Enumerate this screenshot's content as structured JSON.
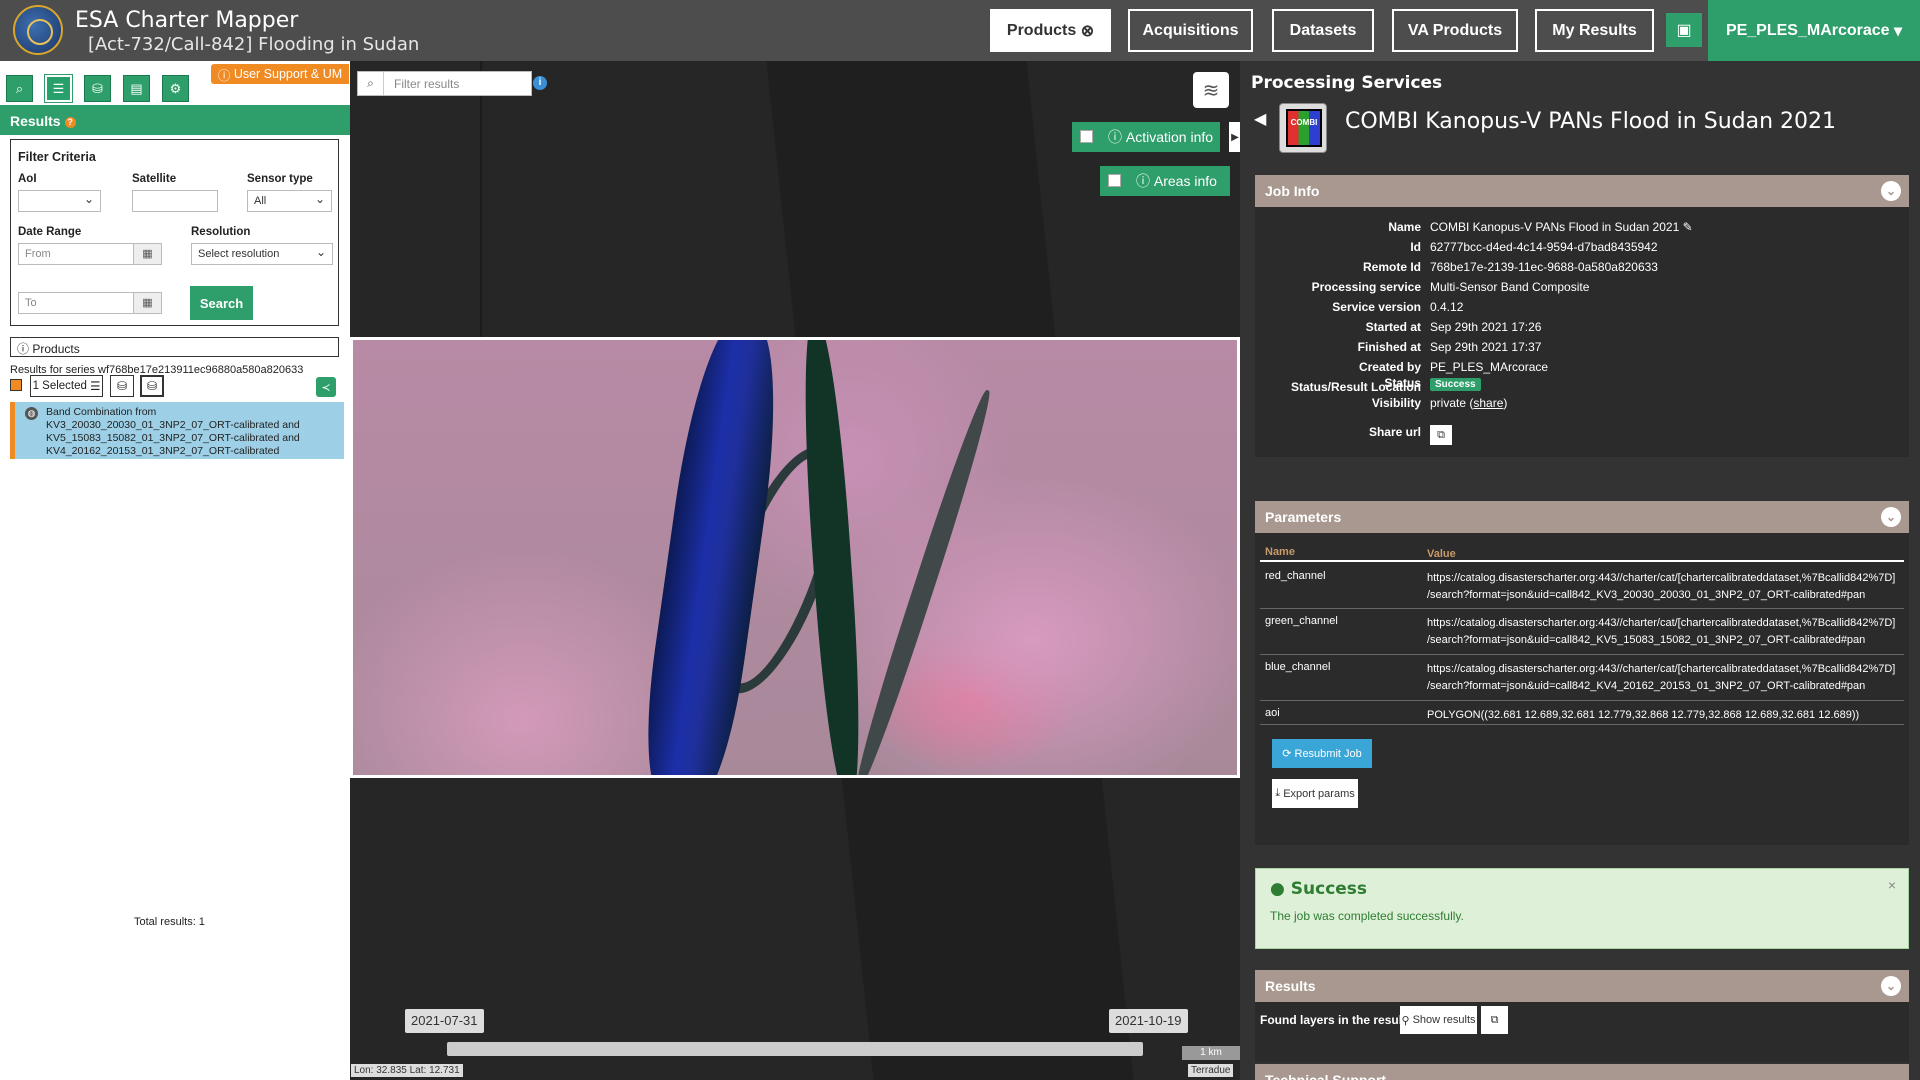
{
  "header": {
    "app_title": "ESA Charter Mapper",
    "activation_title": "[Act-732/Call-842] Flooding in Sudan",
    "nav": {
      "products": "Products",
      "acquisitions": "Acquisitions",
      "datasets": "Datasets",
      "va_products": "VA Products",
      "my_results": "My Results"
    },
    "user": "PE_PLES_MArcorace"
  },
  "left_panel": {
    "support": "User Support & UM",
    "results_heading": "Results",
    "filter": {
      "heading": "Filter Criteria",
      "aoi_label": "AoI",
      "satellite_label": "Satellite",
      "sensor_label": "Sensor type",
      "sensor_value": "All",
      "date_label": "Date Range",
      "from_placeholder": "From",
      "to_placeholder": "To",
      "resolution_label": "Resolution",
      "resolution_value": "Select resolution",
      "search_label": "Search"
    },
    "products_heading": "Products",
    "series_text": "Results for series wf768be17e213911ec96880a580a820633",
    "selected_label": "1 Selected",
    "result_item": "Band Combination from KV3_20030_20030_01_3NP2_07_ORT-calibrated and KV5_15083_15082_01_3NP2_07_ORT-calibrated and KV4_20162_20153_01_3NP2_07_ORT-calibrated",
    "total": "Total results: 1"
  },
  "map": {
    "filter_placeholder": "Filter results",
    "activation_info": "Activation info",
    "areas_info": "Areas info",
    "date_start": "2021-07-31",
    "date_end": "2021-10-19",
    "scale": "1 km",
    "coords": "Lon: 32.835 Lat: 12.731",
    "credit": "Terradue"
  },
  "right_panel": {
    "section_title": "Processing Services",
    "service_title": "COMBI Kanopus-V PANs Flood in Sudan 2021",
    "icon_text": "COMBI",
    "job_info": {
      "heading": "Job Info",
      "rows": [
        {
          "k": "Name",
          "v": "COMBI Kanopus-V PANs Flood in Sudan 2021 ✎"
        },
        {
          "k": "Id",
          "v": "62777bcc-d4ed-4c14-9594-d7bad8435942"
        },
        {
          "k": "Remote Id",
          "v": "768be17e-2139-11ec-9688-0a580a820633"
        },
        {
          "k": "Processing service",
          "v": "Multi-Sensor Band Composite"
        },
        {
          "k": "Service version",
          "v": "0.4.12"
        },
        {
          "k": "Started at",
          "v": "Sep 29th 2021 17:26"
        },
        {
          "k": "Finished at",
          "v": "Sep 29th 2021 17:37"
        },
        {
          "k": "Created by",
          "v": "PE_PLES_MArcorace"
        },
        {
          "k": "Status/Result Location",
          "v": "⇗"
        }
      ],
      "status_label": "Status",
      "status_value": "Success",
      "visibility_label": "Visibility",
      "visibility_value": "private",
      "share_link": "share",
      "share_url_label": "Share url"
    },
    "parameters": {
      "heading": "Parameters",
      "col_name": "Name",
      "col_value": "Value",
      "rows": [
        {
          "name": "red_channel",
          "line1": "https://catalog.disasterscharter.org:443//charter/cat/[chartercalibrateddataset,%7Bcallid842%7D]",
          "line2": "/search?format=json&uid=call842_KV3_20030_20030_01_3NP2_07_ORT-calibrated#pan"
        },
        {
          "name": "green_channel",
          "line1": "https://catalog.disasterscharter.org:443//charter/cat/[chartercalibrateddataset,%7Bcallid842%7D]",
          "line2": "/search?format=json&uid=call842_KV5_15083_15082_01_3NP2_07_ORT-calibrated#pan"
        },
        {
          "name": "blue_channel",
          "line1": "https://catalog.disasterscharter.org:443//charter/cat/[chartercalibrateddataset,%7Bcallid842%7D]",
          "line2": "/search?format=json&uid=call842_KV4_20162_20153_01_3NP2_07_ORT-calibrated#pan"
        },
        {
          "name": "aoi",
          "line1": "POLYGON((32.681 12.689,32.681 12.779,32.868 12.779,32.868 12.689,32.681 12.689))",
          "line2": ""
        }
      ],
      "resubmit": "Resubmit Job",
      "export": "Export params"
    },
    "success": {
      "title": "Success",
      "message": "The job was completed successfully."
    },
    "results": {
      "heading": "Results",
      "found_text": "Found layers in the result.",
      "show_results": "Show results"
    },
    "tech_support": "Technical Support"
  }
}
